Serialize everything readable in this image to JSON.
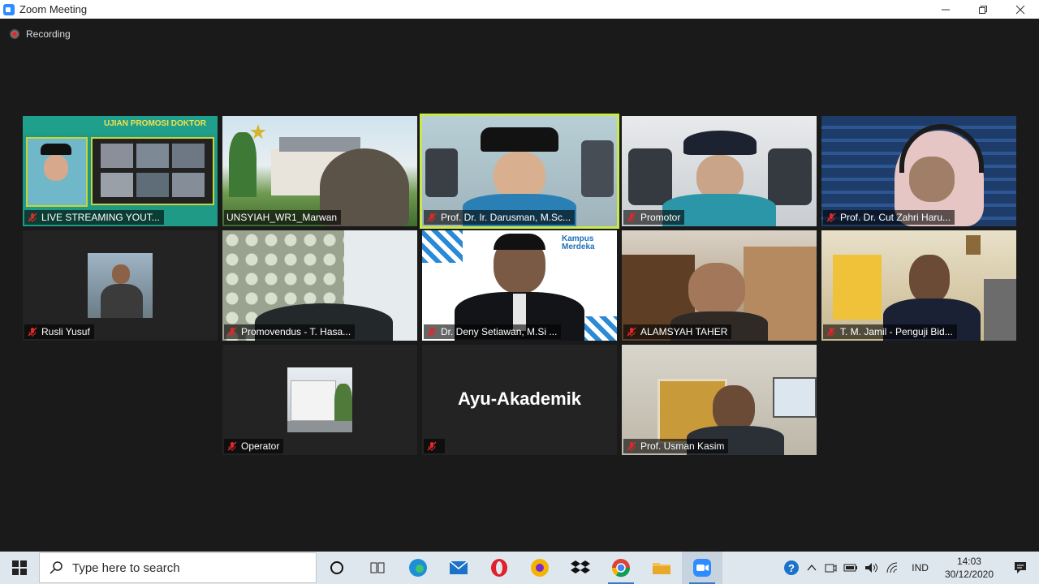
{
  "window": {
    "title": "Zoom Meeting"
  },
  "recording": {
    "label": "Recording"
  },
  "participants": [
    {
      "name": "LIVE STREAMING YOUT...",
      "muted": true,
      "banner": "UJIAN PROMOSI DOKTOR"
    },
    {
      "name": "UNSYIAH_WR1_Marwan",
      "muted": false
    },
    {
      "name": "Prof. Dr. Ir. Darusman, M.Sc...",
      "muted": true,
      "active_speaker": true
    },
    {
      "name": "Promotor",
      "muted": true
    },
    {
      "name": "Prof. Dr. Cut Zahri Haru...",
      "muted": true
    },
    {
      "name": "Rusli Yusuf",
      "muted": true
    },
    {
      "name": "Promovendus - T. Hasa...",
      "muted": true
    },
    {
      "name": "Dr. Deny Setiawan, M.Si ...",
      "muted": true,
      "logo_text": "Kampus Merdeka"
    },
    {
      "name": "ALAMSYAH TAHER",
      "muted": true
    },
    {
      "name": "T. M. Jamil - Penguji Bid...",
      "muted": true
    },
    {
      "name": "Operator",
      "muted": true
    },
    {
      "name": "",
      "muted": true,
      "display_name": "Ayu-Akademik"
    },
    {
      "name": "Prof. Usman Kasim",
      "muted": true
    }
  ],
  "taskbar": {
    "search_placeholder": "Type here to search",
    "language": "IND",
    "time": "14:03",
    "date": "30/12/2020"
  },
  "colors": {
    "active_border": "#c9e84a",
    "mute_red": "#e02828",
    "zoom_blue": "#2d8cff"
  }
}
